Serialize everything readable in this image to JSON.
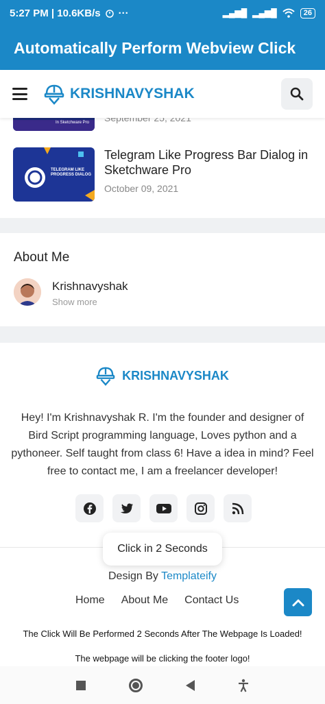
{
  "status_bar": {
    "time_speed": "5:27 PM | 10.6KB/s",
    "signal1": "▂▄▆█",
    "signal2": "▂▄▆█",
    "battery": "26"
  },
  "app_bar": {
    "title": "Automatically Perform Webview Click"
  },
  "site_header": {
    "brand": "KRISHNAVYSHAK"
  },
  "posts": [
    {
      "date": "September 25, 2021",
      "thumb_caption": "In Sketchware Pro"
    },
    {
      "title": "Telegram Like Progress Bar Dialog in Sketchware Pro",
      "date": "October 09, 2021",
      "thumb_caption": "TELEGRAM LIKE PROGRESS DIALOG"
    }
  ],
  "about": {
    "heading": "About Me",
    "name": "Krishnavyshak",
    "link": "Show more"
  },
  "footer": {
    "brand": "KRISHNAVYSHAK",
    "bio": "Hey! I'm Krishnavyshak R. I'm the founder and designer of Bird Script programming language, Loves python and a pythoneer. Self taught from class 6! Have a idea in mind? Feel free to contact me, I am a freelancer developer!",
    "design_by_prefix": "Design By ",
    "design_by_brand": "Templateify",
    "nav": [
      "Home",
      "About Me",
      "Contact Us"
    ]
  },
  "toast": {
    "text": "Click in 2 Seconds"
  },
  "notes": {
    "line1": "The Click Will Be Performed 2 Seconds After The Webpage Is Loaded!",
    "line2": "The webpage will be clicking the footer logo!"
  },
  "colors": {
    "accent": "#1b88c7"
  }
}
